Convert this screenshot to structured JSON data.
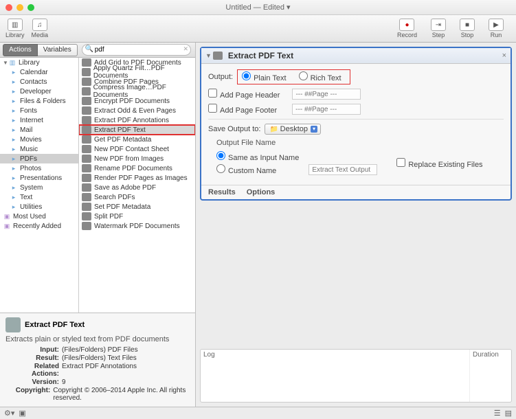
{
  "window": {
    "title": "Untitled — Edited ▾"
  },
  "toolbar": {
    "left": [
      {
        "label": "Library",
        "name": "library-button"
      },
      {
        "label": "Media",
        "name": "media-button"
      }
    ],
    "right": [
      {
        "label": "Record",
        "name": "record-button"
      },
      {
        "label": "Step",
        "name": "step-button"
      },
      {
        "label": "Stop",
        "name": "stop-button"
      },
      {
        "label": "Run",
        "name": "run-button"
      }
    ]
  },
  "tabs": {
    "actions": "Actions",
    "variables": "Variables"
  },
  "search": {
    "value": "pdf",
    "placeholder": "Search"
  },
  "sidebar": {
    "root": "Library",
    "items": [
      "Calendar",
      "Contacts",
      "Developer",
      "Files & Folders",
      "Fonts",
      "Internet",
      "Mail",
      "Movies",
      "Music",
      "PDFs",
      "Photos",
      "Presentations",
      "System",
      "Text",
      "Utilities"
    ],
    "bottom": [
      "Most Used",
      "Recently Added"
    ],
    "selected": "PDFs"
  },
  "actions": [
    "Add Grid to PDF Documents",
    "Apply Quartz Filt…PDF Documents",
    "Combine PDF Pages",
    "Compress Image…PDF Documents",
    "Encrypt PDF Documents",
    "Extract Odd & Even Pages",
    "Extract PDF Annotations",
    "Extract PDF Text",
    "Get PDF Metadata",
    "New PDF Contact Sheet",
    "New PDF from Images",
    "Rename PDF Documents",
    "Render PDF Pages as Images",
    "Save as Adobe PDF",
    "Search PDFs",
    "Set PDF Metadata",
    "Split PDF",
    "Watermark PDF Documents"
  ],
  "highlighted_action_index": 7,
  "card": {
    "title": "Extract PDF Text",
    "output_label": "Output:",
    "output_options": [
      "Plain Text",
      "Rich Text"
    ],
    "output_selected": 0,
    "add_header": {
      "label": "Add Page Header",
      "placeholder": "--- ##Page ---",
      "checked": false
    },
    "add_footer": {
      "label": "Add Page Footer",
      "placeholder": "--- ##Page ---",
      "checked": false
    },
    "save_label": "Save Output to:",
    "save_value": "Desktop",
    "ofn_label": "Output File Name",
    "ofn_same": "Same as Input Name",
    "ofn_custom": "Custom Name",
    "ofn_placeholder": "Extract Text Output",
    "replace_label": "Replace Existing Files",
    "footer_tabs": [
      "Results",
      "Options"
    ]
  },
  "log": {
    "log_hdr": "Log",
    "dur_hdr": "Duration"
  },
  "info": {
    "title": "Extract PDF Text",
    "desc": "Extracts plain or styled text from PDF documents",
    "meta": [
      {
        "k": "Input:",
        "v": "(Files/Folders) PDF Files"
      },
      {
        "k": "Result:",
        "v": "(Files/Folders) Text Files"
      },
      {
        "k": "Related Actions:",
        "v": "Extract PDF Annotations"
      },
      {
        "k": "Version:",
        "v": "9"
      },
      {
        "k": "Copyright:",
        "v": "Copyright © 2006–2014 Apple Inc. All rights reserved."
      }
    ]
  }
}
